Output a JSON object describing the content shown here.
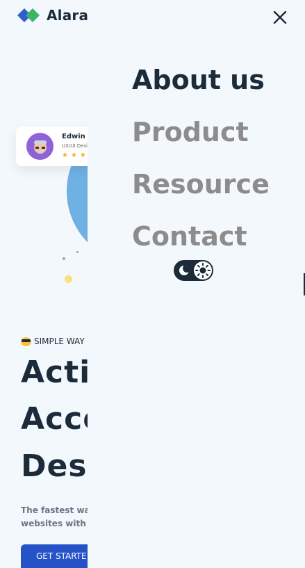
{
  "brand": {
    "name": "Alara"
  },
  "menu": {
    "items": [
      {
        "label": "About us",
        "active": true
      },
      {
        "label": "Product",
        "active": false
      },
      {
        "label": "Resource",
        "active": false
      },
      {
        "label": "Contact",
        "active": false
      }
    ],
    "close_icon": "close-icon",
    "theme_toggle": {
      "icons": [
        "moon-icon",
        "sun-icon"
      ]
    }
  },
  "background_page": {
    "profile_card": {
      "name": "Edwin M",
      "role": "UX/UI Desi",
      "stars": "★★★"
    },
    "eyebrow": "SIMPLE WAY",
    "hero_lines": [
      "Acti",
      "Acce",
      "Desi"
    ],
    "subtitle_lines": [
      "The fastest way",
      "websites with r"
    ],
    "cta_label": "GET STARTE"
  },
  "colors": {
    "background": "#f3f8fc",
    "heading": "#1c2b3a",
    "menu_inactive": "#8c8c8c",
    "accent_blue": "#2553c7",
    "logo_blue": "#2f5fd0",
    "logo_green": "#3cb36a"
  }
}
